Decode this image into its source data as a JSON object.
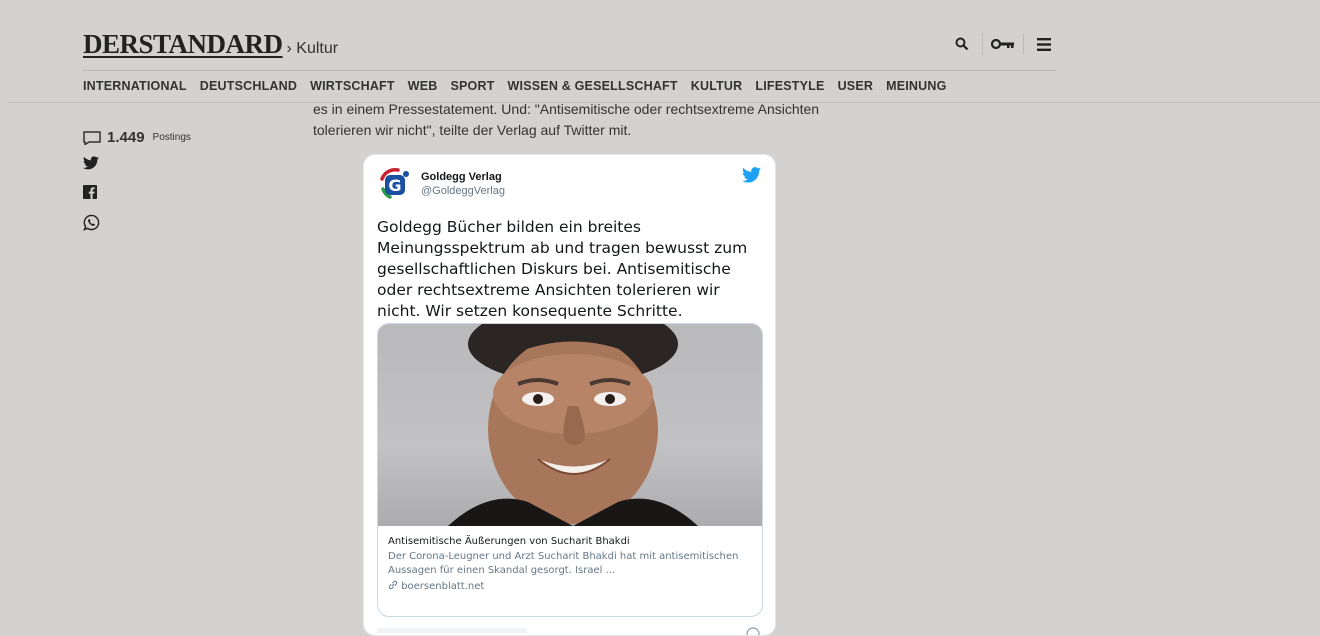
{
  "header": {
    "logo": "DERSTANDARD",
    "section": "› Kultur",
    "icons": [
      "search-icon",
      "key-icon",
      "menu-icon"
    ]
  },
  "nav": [
    "INTERNATIONAL",
    "DEUTSCHLAND",
    "WIRTSCHAFT",
    "WEB",
    "SPORT",
    "WISSEN & GESELLSCHAFT",
    "KULTUR",
    "LIFESTYLE",
    "USER",
    "MEINUNG"
  ],
  "article": {
    "line1": "es in einem Pressestatement. Und: \"Antisemitische oder rechtsextreme Ansichten",
    "line2": "tolerieren wir nicht\", teilte der Verlag auf Twitter mit."
  },
  "sidebar": {
    "postings_count": "1.449",
    "postings_label": "Postings",
    "share_icons": [
      "twitter-icon",
      "facebook-icon",
      "whatsapp-icon"
    ]
  },
  "tweet": {
    "name": "Goldegg Verlag",
    "handle": "@GoldeggVerlag",
    "text": "Goldegg Bücher bilden ein breites Meinungsspektrum ab und tragen bewusst zum gesellschaftlichen Diskurs bei. Antisemitische oder rechtsextreme Ansichten tolerieren wir nicht. Wir setzen  konsequente Schritte.",
    "card": {
      "title": "Antisemitische Äußerungen von Sucharit Bhakdi",
      "description": "Der Corona-Leugner und Arzt Sucharit Bhakdi hat mit antisemitischen Aussagen für einen Skandal gesorgt. Israel ...",
      "domain": "boersenblatt.net"
    }
  },
  "colors": {
    "page_bg": "#d3d2d0",
    "twitter_blue": "#1da1f2",
    "card_border": "#ccd6dd"
  }
}
